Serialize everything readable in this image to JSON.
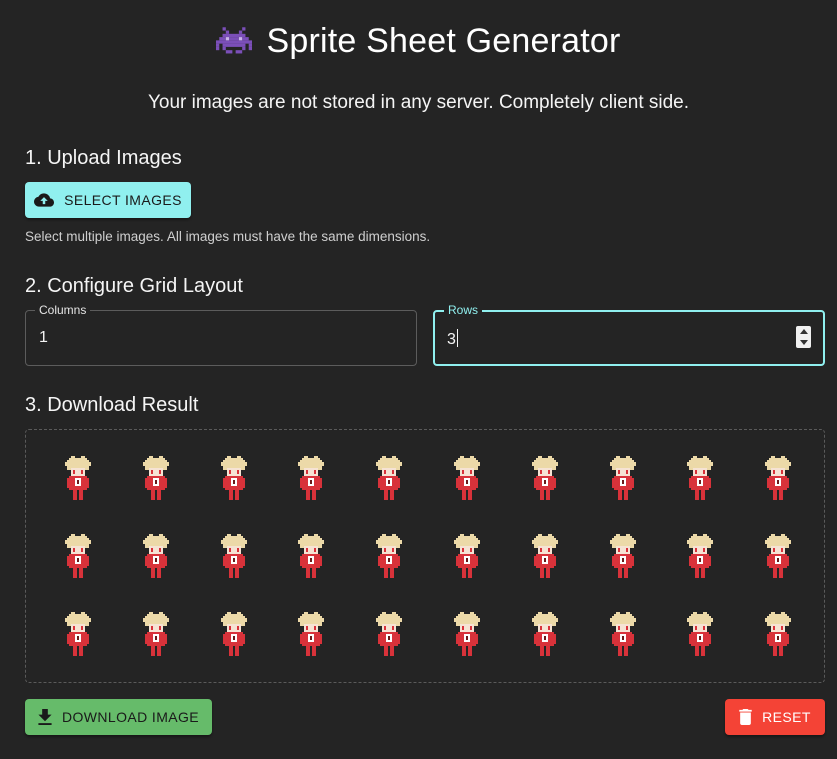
{
  "header": {
    "title": "Sprite Sheet Generator",
    "title_icon": "space-invader-icon",
    "subtitle": "Your images are not stored in any server. Completely client side."
  },
  "upload": {
    "heading": "1. Upload Images",
    "button_label": "SELECT IMAGES",
    "button_icon": "cloud-upload-icon",
    "helper_text": "Select multiple images. All images must have the same dimensions."
  },
  "grid": {
    "heading": "2. Configure Grid Layout",
    "columns_label": "Columns",
    "columns_value": "1",
    "rows_label": "Rows",
    "rows_value": "3"
  },
  "result": {
    "heading": "3. Download Result",
    "sprite_rows": 3,
    "sprite_cols": 10,
    "download_label": "DOWNLOAD IMAGE",
    "download_icon": "download-icon",
    "reset_label": "RESET",
    "reset_icon": "trash-icon"
  },
  "colors": {
    "background": "#242424",
    "accent": "#90f0ef",
    "download": "#66bb6a",
    "reset": "#f44336"
  }
}
